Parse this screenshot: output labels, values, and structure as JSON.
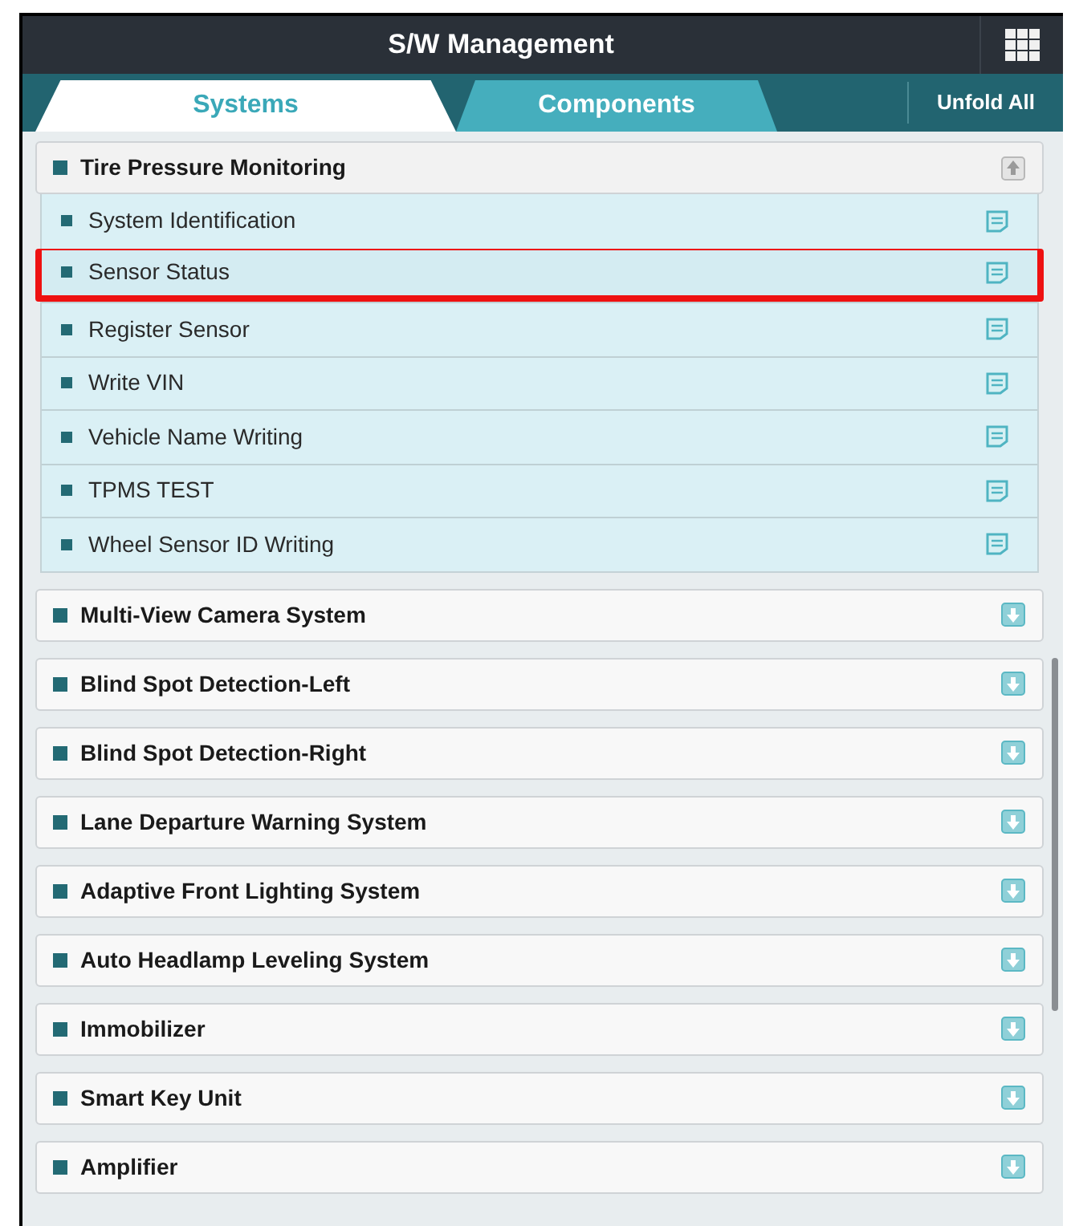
{
  "header": {
    "title": "S/W Management"
  },
  "tabs": [
    {
      "label": "Systems",
      "selected": true
    },
    {
      "label": "Components",
      "selected": false
    }
  ],
  "unfold_all": "Unfold All",
  "groups": [
    {
      "title": "Tire Pressure Monitoring",
      "expanded": true,
      "items": [
        {
          "label": "System Identification",
          "highlighted": false
        },
        {
          "label": "Sensor Status",
          "highlighted": true
        },
        {
          "label": "Register Sensor",
          "highlighted": false
        },
        {
          "label": "Write VIN",
          "highlighted": false
        },
        {
          "label": "Vehicle Name Writing",
          "highlighted": false
        },
        {
          "label": "TPMS TEST",
          "highlighted": false
        },
        {
          "label": "Wheel Sensor ID Writing",
          "highlighted": false
        }
      ]
    },
    {
      "title": "Multi-View Camera System",
      "expanded": false
    },
    {
      "title": "Blind Spot Detection-Left",
      "expanded": false
    },
    {
      "title": "Blind Spot Detection-Right",
      "expanded": false
    },
    {
      "title": "Lane Departure Warning System",
      "expanded": false
    },
    {
      "title": "Adaptive Front Lighting System",
      "expanded": false
    },
    {
      "title": "Auto Headlamp Leveling System",
      "expanded": false
    },
    {
      "title": "Immobilizer",
      "expanded": false
    },
    {
      "title": "Smart Key Unit",
      "expanded": false
    },
    {
      "title": "Amplifier",
      "expanded": false
    }
  ]
}
